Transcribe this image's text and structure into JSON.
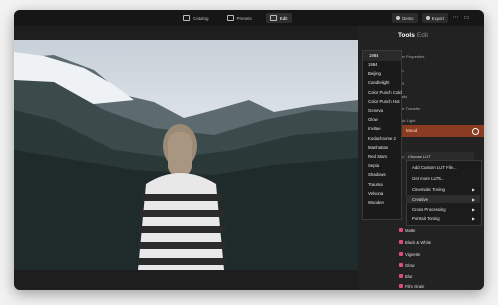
{
  "topbar": {
    "tabs": [
      {
        "label": "Catalog",
        "icon": "catalog-icon"
      },
      {
        "label": "Presets",
        "icon": "presets-icon"
      },
      {
        "label": "Edit",
        "icon": "edit-icon"
      }
    ],
    "right_buttons": [
      "Demo",
      "Export"
    ]
  },
  "sidebar": {
    "title": "Tools",
    "title_suffix": "Edit",
    "rows": [
      "Layer Properties",
      "Crop",
      "RAW",
      "Details",
      "Color Transfer",
      "Magic Light",
      "Exposure",
      "Mood",
      "Curves"
    ],
    "orange_label": "Mood",
    "select_value": "Choose LUT",
    "submenu": [
      {
        "label": "Add Custom LUT File...",
        "arrow": false
      },
      {
        "label": "Get more LUTs...",
        "arrow": false
      },
      {
        "label": "Cinematic Toning",
        "arrow": true
      },
      {
        "label": "Creative",
        "arrow": true
      },
      {
        "label": "Cross Processing",
        "arrow": true
      },
      {
        "label": "Portrait Toning",
        "arrow": true
      }
    ],
    "lower_items": [
      {
        "label": "Matte",
        "color": "#e24a7a"
      },
      {
        "label": "Black & White",
        "color": "#e24a7a"
      },
      {
        "label": "Vignette",
        "color": "#e24a7a"
      },
      {
        "label": "Glow",
        "color": "#e24a7a"
      },
      {
        "label": "Blur",
        "color": "#e24a7a"
      },
      {
        "label": "Film Grain",
        "color": "#e24a7a"
      }
    ]
  },
  "dropdown": {
    "header": "1984",
    "items": [
      "1984",
      "Beijing",
      "Candlelight",
      "Color Punch Cold",
      "Color Punch Hot",
      "Geneva",
      "Glow",
      "Invitae",
      "Kodachrome 2",
      "Manhattan",
      "Red Stars",
      "Sepia",
      "Shadows",
      "Trauma",
      "Velvona",
      "Wooden"
    ]
  }
}
